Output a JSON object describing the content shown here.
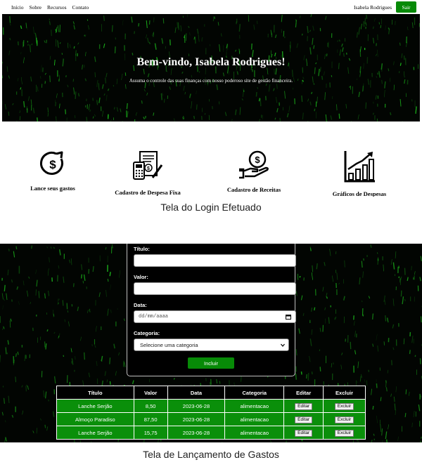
{
  "login_screen": {
    "nav": {
      "links": [
        "Início",
        "Sobre",
        "Recursos",
        "Contato"
      ],
      "user_name": "Isabela Rodrigues",
      "logout_label": "Sair"
    },
    "hero": {
      "title": "Bem-vindo, Isabela Rodrigues!",
      "subtitle": "Assuma o controle das suas finanças com nosso poderoso site de gestão financeira."
    },
    "features": [
      {
        "label": "Lance seus gastos",
        "icon": "dollar-growth-icon"
      },
      {
        "label": "Cadastro de Despesa Fixa",
        "icon": "bill-calculator-icon"
      },
      {
        "label": "Cadastro de Receitas",
        "icon": "hand-coin-icon"
      },
      {
        "label": "Gráficos de Despesas",
        "icon": "bar-chart-up-icon"
      }
    ],
    "caption": "Tela do Login Efetuado"
  },
  "expense_screen": {
    "form": {
      "title_label": "Título:",
      "title_value": "",
      "value_label": "Valor:",
      "value_value": "",
      "date_label": "Data:",
      "date_placeholder": "dd/mm/aaaa",
      "category_label": "Categoria:",
      "category_selected": "Selecione uma categoria",
      "submit_label": "Incluir"
    },
    "table": {
      "headers": [
        "Título",
        "Valor",
        "Data",
        "Categoria",
        "Editar",
        "Excluir"
      ],
      "rows": [
        {
          "titulo": "Lanche Serjão",
          "valor": "8,50",
          "data": "2023-06-28",
          "categoria": "alimentacao",
          "editar": "Editar",
          "excluir": "Excluir"
        },
        {
          "titulo": "Almoço Paradiso",
          "valor": "87,50",
          "data": "2023-06-28",
          "categoria": "alimentacao",
          "editar": "Editar",
          "excluir": "Excluir"
        },
        {
          "titulo": "Lanche Serjão",
          "valor": "15,75",
          "data": "2023-06-28",
          "categoria": "alimentacao",
          "editar": "Editar",
          "excluir": "Excluir"
        }
      ]
    },
    "caption": "Tela de Lançamento de Gastos"
  },
  "colors": {
    "accent_green": "#078a07",
    "row_green": "#0a8f0a",
    "dark_bg": "#020502"
  }
}
